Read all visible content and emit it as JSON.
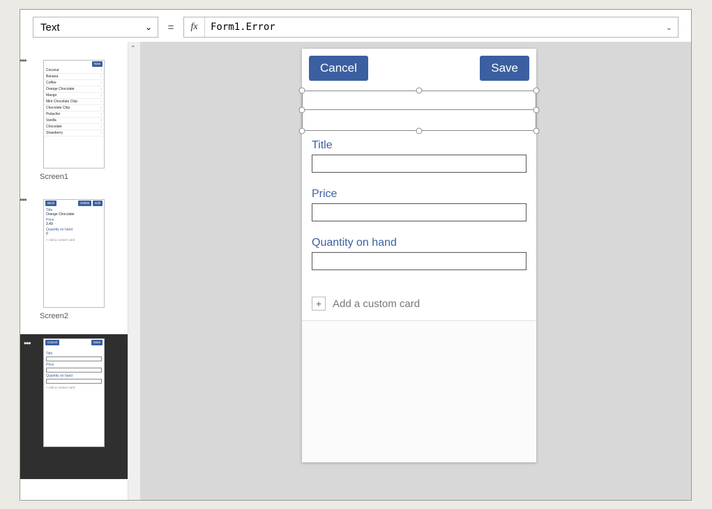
{
  "formula_bar": {
    "property": "Text",
    "equals": "=",
    "fx": "fx",
    "expression": "Form1.Error"
  },
  "thumbnails": {
    "screen1": {
      "label": "Screen1",
      "new_btn": "New",
      "items": [
        "Coconut",
        "Banana",
        "Coffee",
        "Orange Chocolate",
        "Mango",
        "Mint Chocolate Chip",
        "Chocolate Chip",
        "Pistachio",
        "Vanilla",
        "Chocolate",
        "Strawberry"
      ]
    },
    "screen2": {
      "label": "Screen2",
      "back": "Back",
      "delete": "Delete",
      "edit": "Edit",
      "title_lbl": "Title",
      "title_val": "Orange Chocolate",
      "price_lbl": "Price",
      "price_val": "3.49",
      "qty_lbl": "Quantity on hand",
      "qty_val": "0",
      "addcard": "+  Add a custom card"
    },
    "screen3": {
      "cancel": "Cancel",
      "save": "Save",
      "title_lbl": "Title",
      "price_lbl": "Price",
      "qty_lbl": "Quantity on hand",
      "addcard": "+  Add a custom card"
    }
  },
  "app": {
    "cancel": "Cancel",
    "save": "Save",
    "fields": {
      "title": "Title",
      "price": "Price",
      "qty": "Quantity on hand"
    },
    "add_card": "Add a custom card",
    "plus": "+"
  }
}
